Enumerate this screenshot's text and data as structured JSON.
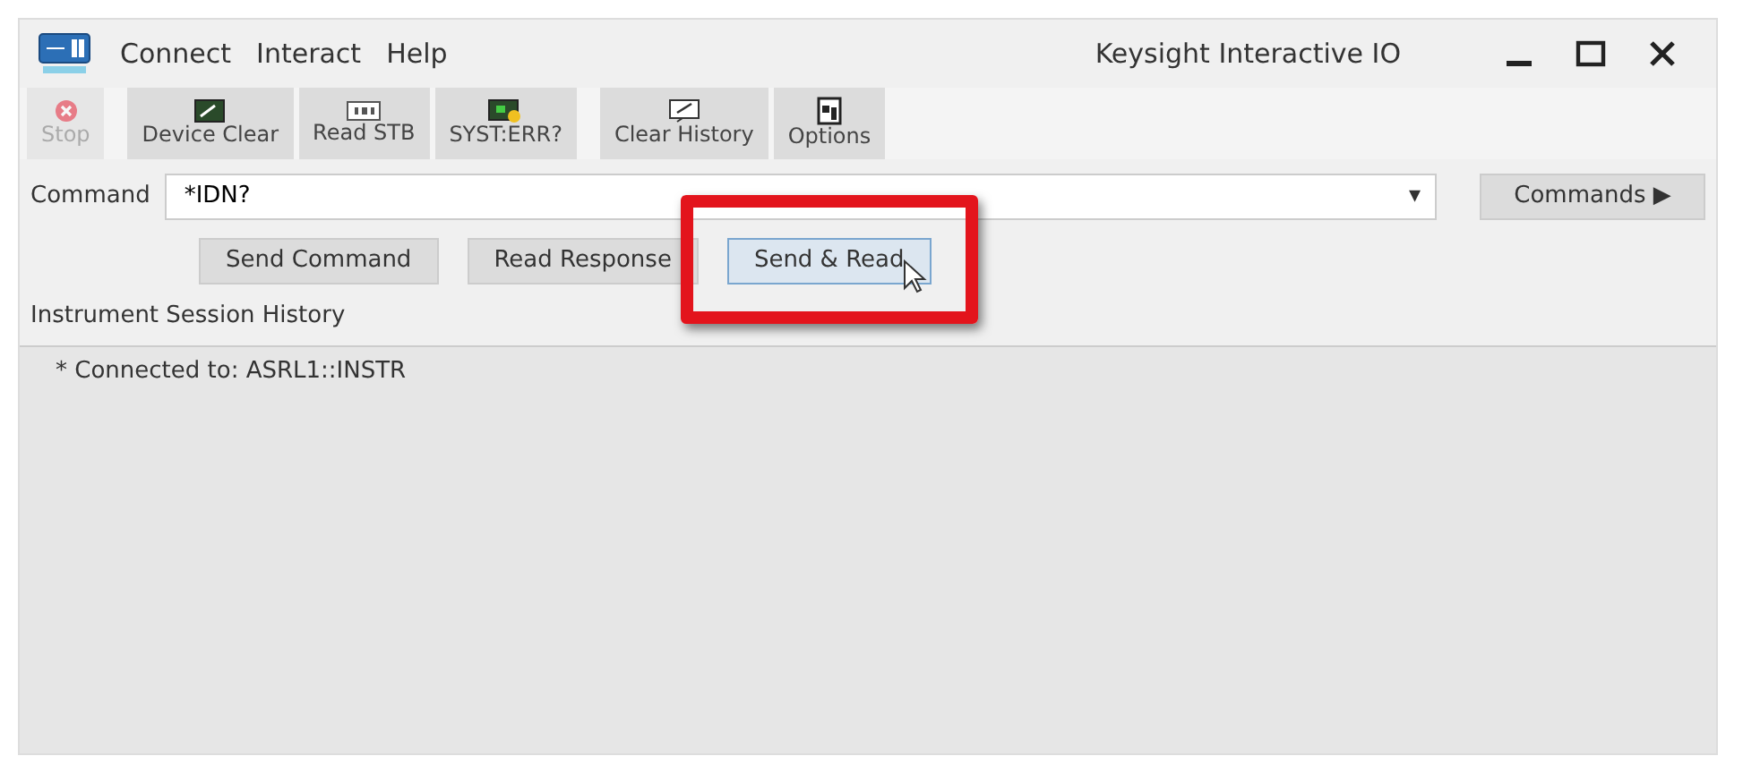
{
  "window": {
    "title": "Keysight Interactive IO"
  },
  "menu": [
    "Connect",
    "Interact",
    "Help"
  ],
  "toolbar_groups": [
    [
      {
        "kind": "stop",
        "label": "Stop",
        "disabled": true
      }
    ],
    [
      {
        "kind": "device-clear",
        "label": "Device Clear",
        "disabled": false
      },
      {
        "kind": "read-stb",
        "label": "Read STB",
        "disabled": false
      },
      {
        "kind": "syst-err",
        "label": "SYST:ERR?",
        "disabled": false
      }
    ],
    [
      {
        "kind": "clear-history",
        "label": "Clear History",
        "disabled": false
      },
      {
        "kind": "options",
        "label": "Options",
        "disabled": false
      }
    ]
  ],
  "command": {
    "label": "Command",
    "value": "*IDN?",
    "dropdown_glyph": "▾",
    "button": "Commands ▶"
  },
  "actions": [
    {
      "label": "Send Command",
      "focused": false,
      "highlighted": false
    },
    {
      "label": "Read Response",
      "focused": false,
      "highlighted": false
    },
    {
      "label": "Send & Read",
      "focused": true,
      "highlighted": true
    }
  ],
  "history": {
    "label": "Instrument Session History",
    "lines": [
      "* Connected to: ASRL1::INSTR"
    ]
  }
}
